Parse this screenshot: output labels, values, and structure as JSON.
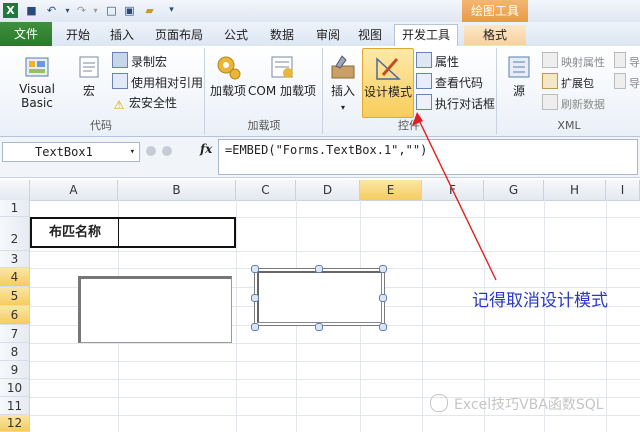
{
  "title_bar": {
    "context_tab_title": "绘图工具"
  },
  "tabs": [
    "文件",
    "开始",
    "插入",
    "页面布局",
    "公式",
    "数据",
    "审阅",
    "视图",
    "开发工具",
    "格式"
  ],
  "ribbon": {
    "code_group": {
      "label": "代码",
      "visual_basic": "Visual Basic",
      "macro": "宏",
      "record_macro": "录制宏",
      "relative_ref": "使用相对引用",
      "macro_security": "宏安全性"
    },
    "addins_group": {
      "label": "加载项",
      "addins": "加载项",
      "com_addins": "COM 加载项"
    },
    "controls_group": {
      "label": "控件",
      "insert": "插入",
      "design_mode": "设计模式",
      "properties": "属性",
      "view_code": "查看代码",
      "run_dialog": "执行对话框"
    },
    "source_btn": "源",
    "xml_group": {
      "label": "XML",
      "map_props": "映射属性",
      "expansion": "扩展包",
      "refresh": "刷新数据",
      "import": "导",
      "export": "导"
    }
  },
  "formula_bar": {
    "name_box": "TextBox1",
    "fx": "fx",
    "formula": "=EMBED(\"Forms.TextBox.1\",\"\")"
  },
  "columns": [
    "A",
    "B",
    "C",
    "D",
    "E",
    "F",
    "G",
    "H",
    "I"
  ],
  "rows": [
    "1",
    "2",
    "3",
    "4",
    "5",
    "6",
    "7",
    "8",
    "9",
    "10",
    "11",
    "12"
  ],
  "cells": {
    "A2": "布匹名称"
  },
  "annotation": "记得取消设计模式",
  "watermark": "Excel技巧VBA函数SQL",
  "colors": {
    "file_tab": "#2b7a2b",
    "context_tab": "#e89a3f",
    "annotation": "#2a37c8",
    "arrow": "#e02020",
    "selected_header": "#f5cc5e"
  }
}
